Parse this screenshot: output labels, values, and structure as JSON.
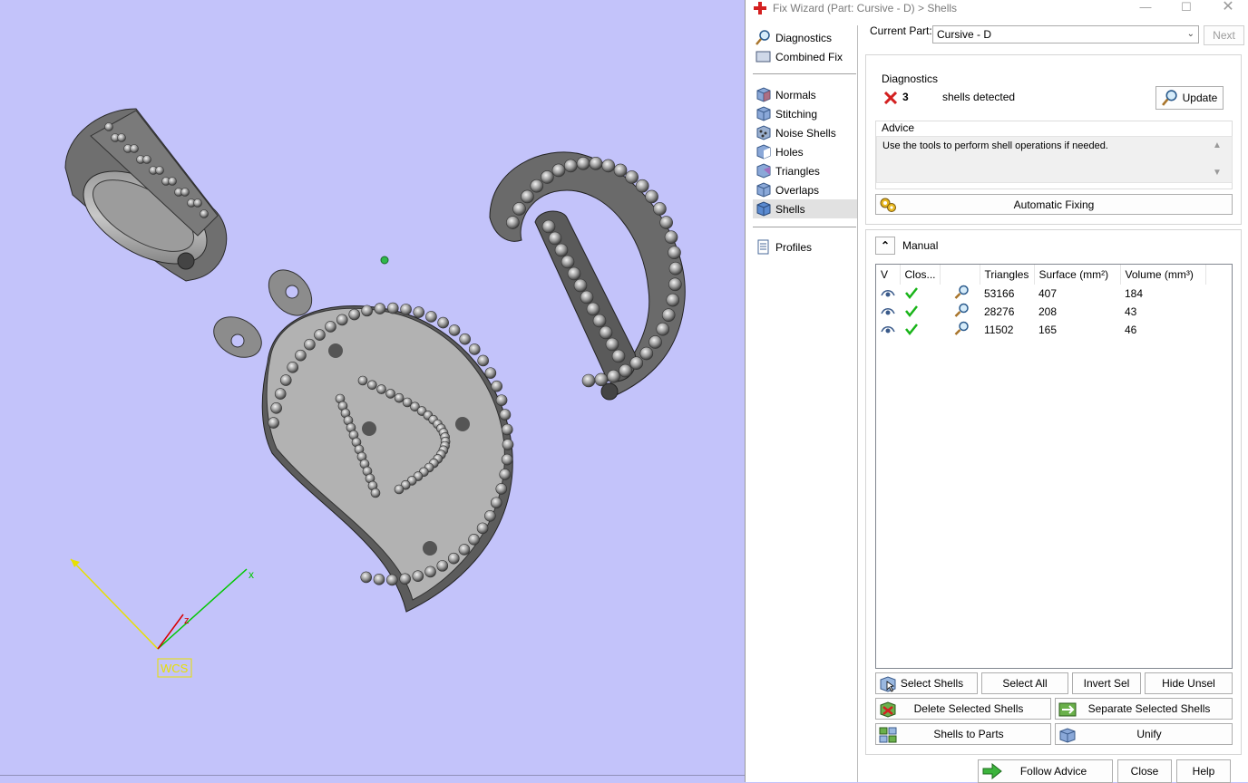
{
  "viewport": {
    "axis_labels": {
      "x": "x",
      "z": "z"
    },
    "wcs_label": "WCS"
  },
  "window": {
    "title": "Fix Wizard (Part: Cursive - D) > Shells",
    "minimize_label": "—",
    "maximize_label": "☐",
    "close_label": "✕"
  },
  "nav": {
    "items": [
      {
        "label": "Diagnostics",
        "icon": "magnifier-icon"
      },
      {
        "label": "Combined Fix",
        "icon": "combined-fix-icon"
      },
      {
        "label": "Normals",
        "icon": "normals-cube-icon"
      },
      {
        "label": "Stitching",
        "icon": "stitching-cube-icon"
      },
      {
        "label": "Noise Shells",
        "icon": "noise-shells-icon"
      },
      {
        "label": "Holes",
        "icon": "holes-cube-icon"
      },
      {
        "label": "Triangles",
        "icon": "triangles-cube-icon"
      },
      {
        "label": "Overlaps",
        "icon": "overlaps-cube-icon"
      },
      {
        "label": "Shells",
        "icon": "shells-cube-icon"
      },
      {
        "label": "Profiles",
        "icon": "profiles-doc-icon"
      }
    ],
    "selected": "Shells"
  },
  "header": {
    "current_part_label": "Current Part:",
    "current_part_value": "Cursive - D",
    "next_label": "Next"
  },
  "diagnostics": {
    "title": "Diagnostics",
    "count": "3",
    "message": "shells detected",
    "update_label": "Update",
    "advice_title": "Advice",
    "advice_text": "Use the tools to perform shell operations if needed.",
    "automatic_fixing_label": "Automatic Fixing"
  },
  "manual": {
    "title": "Manual",
    "columns": [
      "V",
      "Clos...",
      "",
      "Triangles",
      "Surface (mm²)",
      "Volume (mm³)"
    ],
    "rows": [
      {
        "triangles": "53166",
        "surface": "407",
        "volume": "184"
      },
      {
        "triangles": "28276",
        "surface": "208",
        "volume": "43"
      },
      {
        "triangles": "11502",
        "surface": "165",
        "volume": "46"
      }
    ],
    "buttons": {
      "select_shells": "Select Shells",
      "select_all": "Select All",
      "invert_sel": "Invert Sel",
      "hide_unsel": "Hide Unsel",
      "delete_selected": "Delete Selected Shells",
      "separate_selected": "Separate Selected Shells",
      "shells_to_parts": "Shells to Parts",
      "unify": "Unify"
    }
  },
  "footer": {
    "follow_advice": "Follow Advice",
    "close": "Close",
    "help": "Help"
  },
  "colors": {
    "viewport_bg": "#c3c3fa",
    "check_green": "#18b418",
    "error_red": "#d32020",
    "selection_bg": "#e1e1e1"
  }
}
